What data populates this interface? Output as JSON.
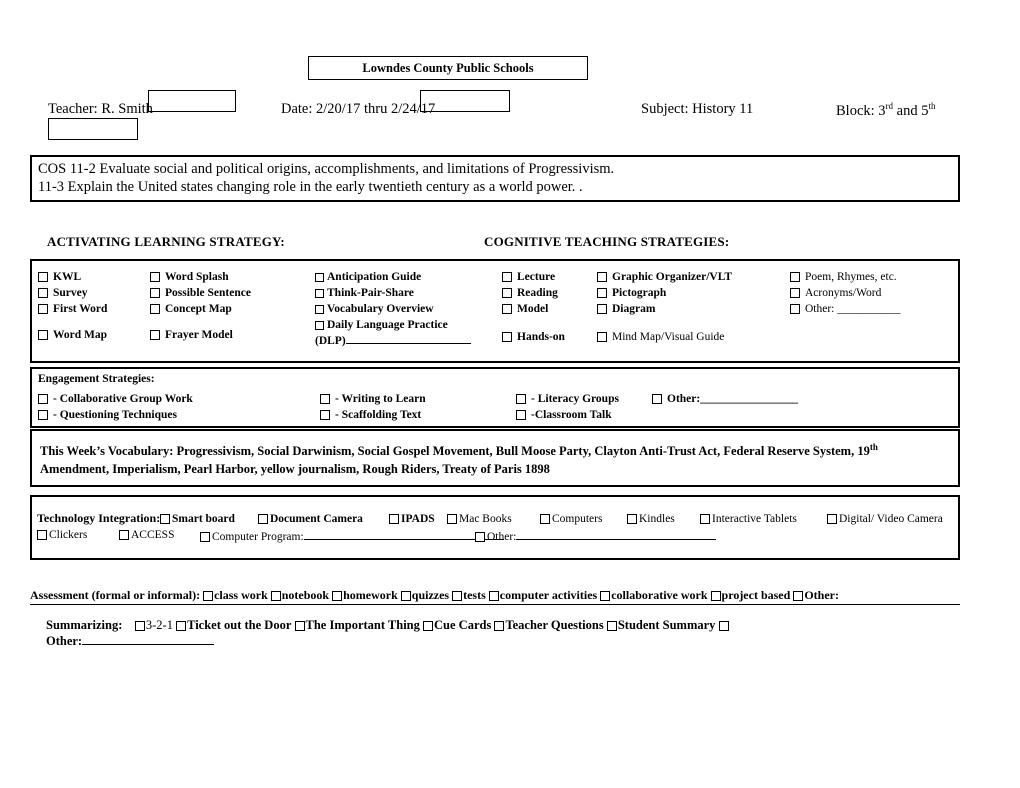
{
  "header": {
    "school": "Lowndes County Public Schools",
    "teacher_label": "Teacher:",
    "teacher_value": "R. Smith",
    "date_label": "Date:",
    "date_value": "2/20/17 thru  2/24/17",
    "subject_label": "Subject:",
    "subject_value": "History 11",
    "block_label": "Block:",
    "block_value_1": "3",
    "block_sup_1": "rd",
    "block_mid": " and 5",
    "block_sup_2": "th"
  },
  "cos": {
    "line1": "COS 11-2 Evaluate social and political origins, accomplishments, and limitations of Progressivism.",
    "line2": "11-3 Explain the United states changing role in the early twentieth century as a world power. ."
  },
  "headings": {
    "activating": "ACTIVATING LEARNING STRATEGY:",
    "cognitive": "COGNITIVE TEACHING STRATEGIES:"
  },
  "activating": {
    "col1": [
      "KWL",
      "Survey",
      "First Word",
      "Word Map"
    ],
    "col2": [
      "Word Splash",
      "Possible Sentence",
      "Concept Map",
      "Frayer Model"
    ],
    "col3": [
      "Anticipation Guide",
      "Think-Pair-Share",
      "Vocabulary Overview",
      "Daily Language Practice",
      "(DLP)"
    ]
  },
  "cognitive": {
    "col1": [
      "Lecture",
      "Reading",
      "Model",
      "Hands-on"
    ],
    "col2": [
      "Graphic Organizer/VLT",
      "Pictograph",
      "Diagram",
      "Mind Map/Visual Guide"
    ],
    "col3": [
      "Poem, Rhymes, etc.",
      "Acronyms/Word",
      "Other: ___________"
    ]
  },
  "engagement": {
    "title": "Engagement Strategies:",
    "items": [
      "- Collaborative Group Work",
      "- Questioning Techniques",
      "- Writing to Learn",
      "-  Scaffolding Text",
      "- Literacy Groups",
      "-Classroom Talk",
      "Other:_________________"
    ]
  },
  "vocabulary": {
    "label": "This Week’s Vocabulary:",
    "line1_a": "  Progressivism, Social Darwinism, Social Gospel Movement, Bull Moose Party, Clayton Anti-Trust Act, Federal Reserve System, 19",
    "line1_sup": "th",
    "line2": "Amendment, Imperialism, Pearl Harbor, yellow journalism,  Rough Riders, Treaty of Paris 1898"
  },
  "technology": {
    "label": "Technology Integration:",
    "row1": [
      "Smart board",
      "Document Camera",
      "IPADS",
      "Mac Books",
      "Computers",
      "Kindles",
      "Interactive Tablets",
      "Digital/ Video Camera"
    ],
    "row2_clickers": "Clickers",
    "row2_access": "ACCESS",
    "row2_program": "Computer Program:",
    "row2_other": "Other:"
  },
  "assessment": {
    "label": "Assessment (formal or informal):",
    "items": [
      "class work",
      "notebook",
      "homework",
      "quizzes",
      "tests",
      "computer activities",
      "collaborative work",
      "project based",
      "Other:"
    ]
  },
  "summarizing": {
    "label": "Summarizing:",
    "items": [
      "3-2-1",
      "Ticket out the Door",
      "The Important Thing",
      "Cue Cards",
      "Teacher Questions",
      "Student Summary",
      ""
    ],
    "other_label": "Other:",
    "other_blank": "__________________"
  }
}
